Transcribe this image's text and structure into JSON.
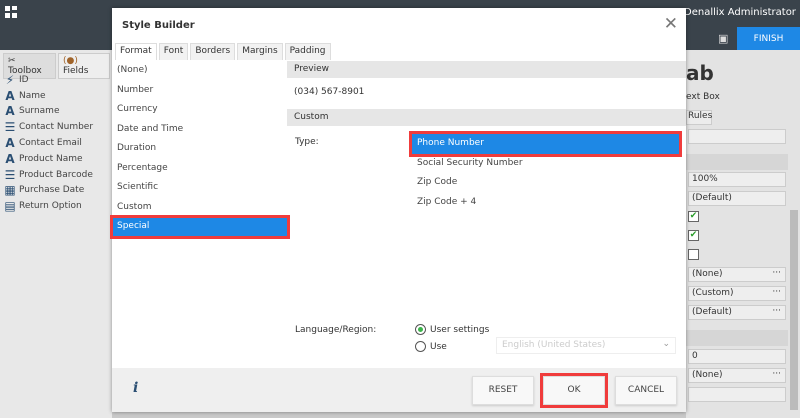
{
  "topbar": {
    "user": "Denallix Administrator",
    "finish": "FINISH",
    "save_icon": "save-icon"
  },
  "left": {
    "tabs": [
      "Toolbox",
      "Fields"
    ],
    "fields": [
      {
        "label": "ID",
        "icon": "id-icon"
      },
      {
        "label": "Name",
        "icon": "text-icon"
      },
      {
        "label": "Surname",
        "icon": "text-icon"
      },
      {
        "label": "Contact Number",
        "icon": "list-icon"
      },
      {
        "label": "Contact Email",
        "icon": "text-icon"
      },
      {
        "label": "Product Name",
        "icon": "text-icon"
      },
      {
        "label": "Product Barcode",
        "icon": "list-icon"
      },
      {
        "label": "Purchase Date",
        "icon": "calendar-icon"
      },
      {
        "label": "Return Option",
        "icon": "choice-icon"
      }
    ]
  },
  "right": {
    "big": "ab",
    "control": "ext Box",
    "rules": "Rules",
    "width": "100%",
    "default1": "(Default)",
    "none1": "(None)",
    "custom": "(Custom)",
    "default2": "(Default)",
    "zero": "0",
    "none2": "(None)",
    "dots": "···"
  },
  "dialog": {
    "title": "Style Builder",
    "tabs": [
      "Format",
      "Font",
      "Borders",
      "Margins",
      "Padding"
    ],
    "formats": [
      "(None)",
      "Number",
      "Currency",
      "Date and Time",
      "Duration",
      "Percentage",
      "Scientific",
      "Custom",
      "Special"
    ],
    "preview_label": "Preview",
    "preview_value": "(034) 567-8901",
    "custom_label": "Custom",
    "type_label": "Type:",
    "types": [
      "Phone Number",
      "Social Security Number",
      "Zip Code",
      "Zip Code + 4"
    ],
    "lang_label": "Language/Region:",
    "radio_user": "User settings",
    "radio_use": "Use",
    "lang_value": "English (United States)",
    "reset": "RESET",
    "ok": "OK",
    "cancel": "CANCEL",
    "info": "i"
  }
}
